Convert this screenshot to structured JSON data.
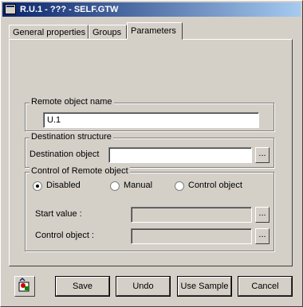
{
  "window": {
    "title": "R.U.1 - ??? - SELF.GTW"
  },
  "tabs": [
    {
      "label": "General properties",
      "active": false
    },
    {
      "label": "Groups",
      "active": false
    },
    {
      "label": "Parameters",
      "active": true
    }
  ],
  "remote_object": {
    "group_label": "Remote object name",
    "value": "U.1"
  },
  "destination": {
    "group_label": "Destination structure",
    "field_label": "Destination object",
    "value": "",
    "browse_label": "..."
  },
  "control": {
    "group_label": "Control of Remote object",
    "options": [
      {
        "label": "Disabled",
        "selected": true
      },
      {
        "label": "Manual",
        "selected": false
      },
      {
        "label": "Control object",
        "selected": false
      }
    ],
    "start_value_label": "Start value :",
    "control_object_label": "Control object :",
    "browse_label": "..."
  },
  "buttons": {
    "save": "Save",
    "undo": "Undo",
    "use_sample": "Use Sample",
    "cancel": "Cancel"
  },
  "icons": {
    "title_icon": "window-icon",
    "tool_icon": "objects-icon"
  }
}
